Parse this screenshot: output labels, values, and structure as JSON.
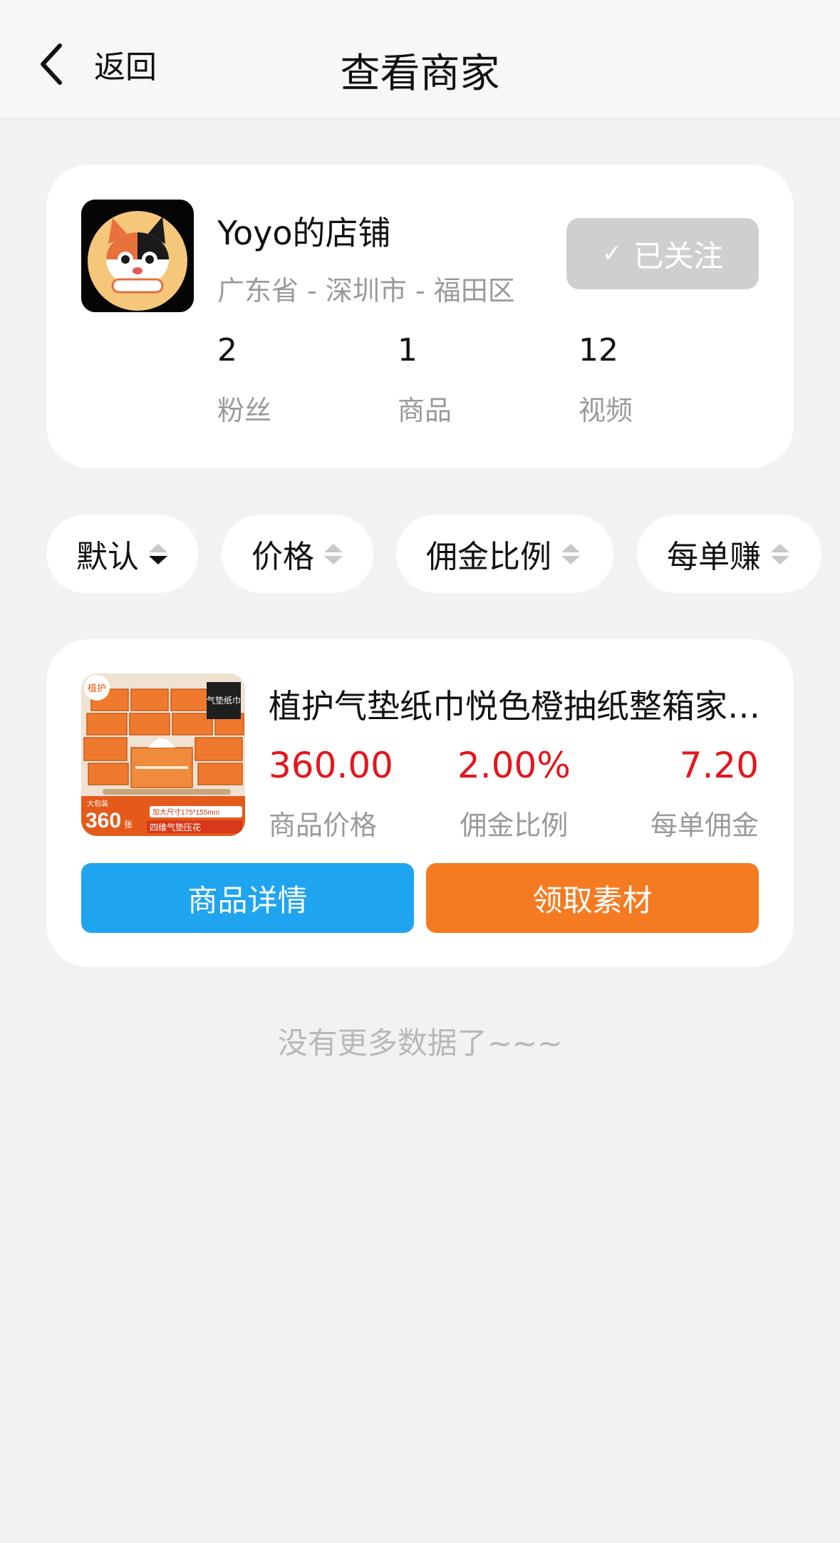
{
  "nav": {
    "back_label": "返回",
    "title": "查看商家"
  },
  "shop": {
    "name": "Yoyo的店铺",
    "location": "广东省 - 深圳市 - 福田区",
    "follow_check": "✓",
    "follow_label": "已关注",
    "stats": [
      {
        "value": "2",
        "label": "粉丝"
      },
      {
        "value": "1",
        "label": "商品"
      },
      {
        "value": "12",
        "label": "视频"
      }
    ]
  },
  "filters": [
    {
      "label": "默认",
      "active": true
    },
    {
      "label": "价格",
      "active": false
    },
    {
      "label": "佣金比例",
      "active": false
    },
    {
      "label": "每单赚",
      "active": false
    }
  ],
  "product": {
    "title": "植护气垫纸巾悦色橙抽纸整箱家用实惠装",
    "image": {
      "brand_tag": "植护",
      "corner_tag": "气垫纸巾",
      "badge_top": "大包装",
      "count": "360",
      "count_unit": "张",
      "size_text": "加大尺寸175*155mm",
      "slogan": "四维气垫压花"
    },
    "metrics": [
      {
        "value": "360.00",
        "label": "商品价格"
      },
      {
        "value": "2.00%",
        "label": "佣金比例"
      },
      {
        "value": "7.20",
        "label": "每单佣金"
      }
    ],
    "detail_button": "商品详情",
    "material_button": "领取素材"
  },
  "footer": {
    "no_more": "没有更多数据了~~~"
  },
  "colors": {
    "price_red": "#e3161d",
    "detail_blue": "#1fa4ef",
    "material_orange": "#f57b22",
    "followed_grey": "#cfcfcf"
  }
}
